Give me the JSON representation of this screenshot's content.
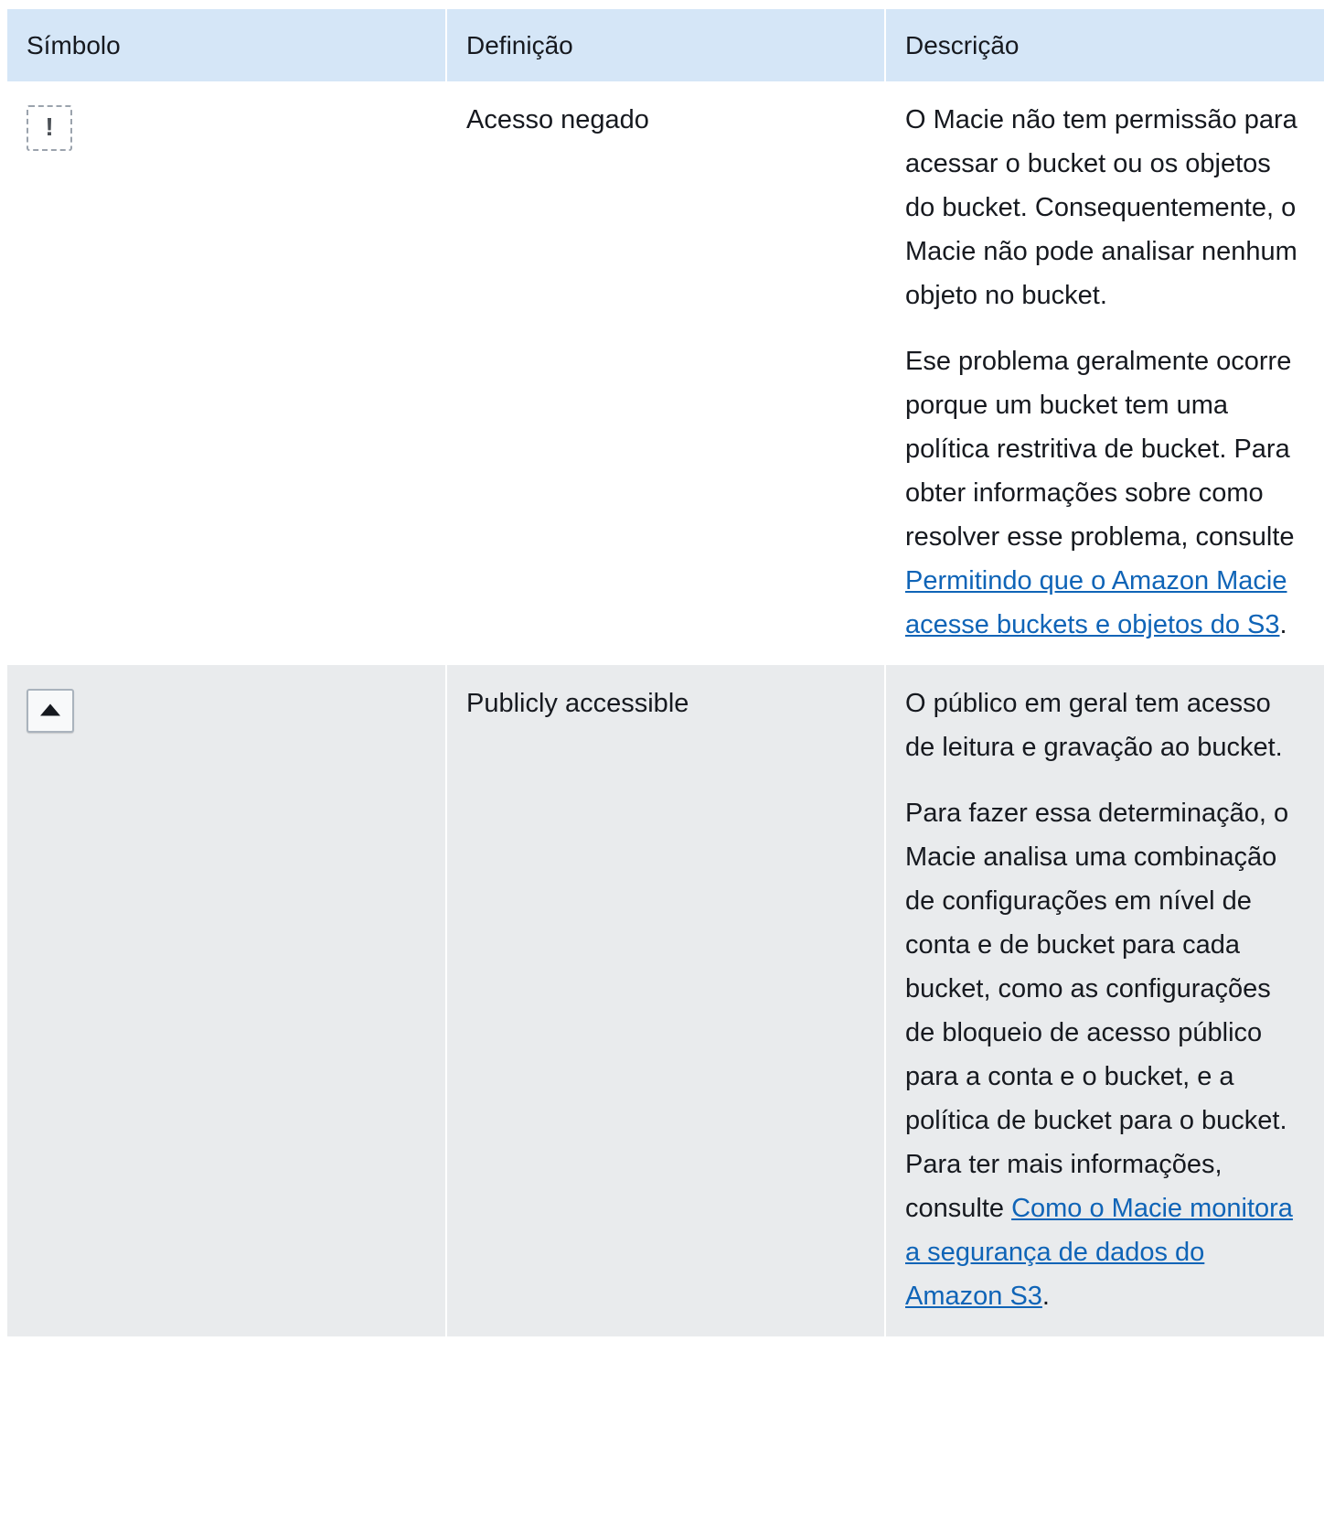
{
  "table": {
    "headers": [
      "Símbolo",
      "Definição",
      "Descrição"
    ],
    "rows": [
      {
        "icon": "access-denied-icon",
        "icon_glyph": "!",
        "definition": "Acesso negado",
        "desc_p1": "O Macie não tem permissão para acessar o bucket ou os objetos do bucket. Consequentemente, o Macie não pode analisar nenhum objeto no bucket.",
        "desc_p2_text": "Ese problema geralmente ocorre porque um bucket tem uma política restritiva de bucket. Para obter informações sobre como resolver esse problema, consulte ",
        "desc_p2_link": "Permitindo que o Amazon Macie acesse buckets e objetos do S3",
        "desc_p2_end": "."
      },
      {
        "icon": "publicly-accessible-icon",
        "definition": "Publicly accessible",
        "desc_p1": "O público em geral tem acesso de leitura e gravação ao bucket.",
        "desc_p2_text": "Para fazer essa determinação, o Macie analisa uma combinação de configurações em nível de conta e de bucket para cada bucket, como as configurações de bloqueio de acesso público para a conta e o bucket, e a política de bucket para o bucket. Para ter mais informações, consulte ",
        "desc_p2_link": "Como o Macie monitora a segurança de dados do Amazon S3",
        "desc_p2_end": "."
      }
    ]
  },
  "colors": {
    "header_bg": "#d5e6f7",
    "alt_row_bg": "#e9ebed",
    "link": "#0f64b7",
    "text": "#16191f"
  }
}
